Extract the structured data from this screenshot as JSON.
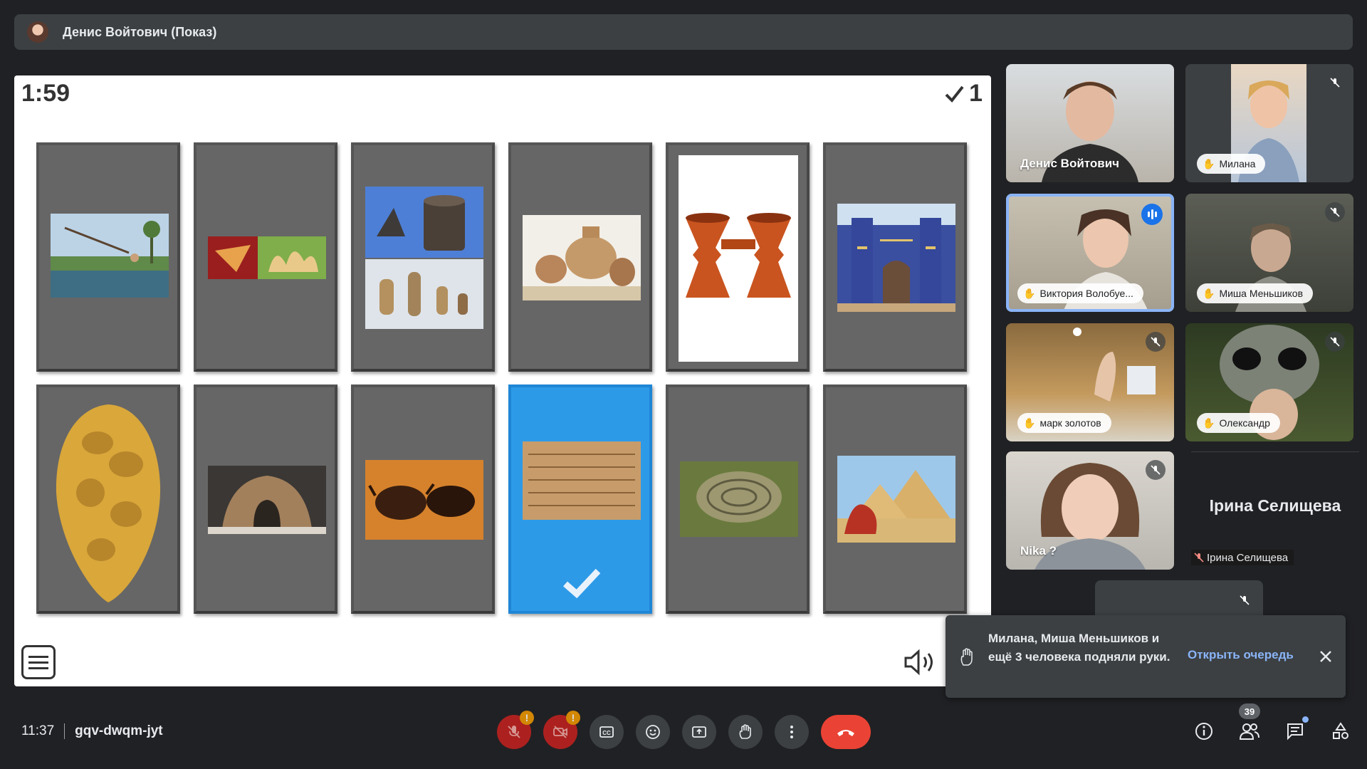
{
  "presenter": {
    "name": "Денис Войтович (Показ)"
  },
  "quiz": {
    "timer": "1:59",
    "score": "1",
    "cards": [
      {
        "icon": "irrigation-photo"
      },
      {
        "icon": "bone-tools-photo"
      },
      {
        "icon": "neolithic-pottery-photo"
      },
      {
        "icon": "pottery-collection-photo"
      },
      {
        "icon": "twin-vessel-photo"
      },
      {
        "icon": "ishtar-gate-photo"
      },
      {
        "icon": "hand-axe-photo"
      },
      {
        "icon": "mammoth-bone-hut-photo"
      },
      {
        "icon": "cave-painting-bison-photo"
      },
      {
        "icon": "cuneiform-tablet-photo",
        "selected": true
      },
      {
        "icon": "ancient-settlement-aerial-photo"
      },
      {
        "icon": "pyramids-camel-photo"
      }
    ]
  },
  "participants": [
    {
      "name": "Денис Войтович",
      "style": "plain",
      "muted": false
    },
    {
      "name": "Милана",
      "style": "pill",
      "hand": true,
      "muted": true
    },
    {
      "name": "Виктория Волобуе...",
      "style": "pill",
      "hand": true,
      "speaking": true
    },
    {
      "name": "Миша Меньшиков",
      "style": "pill",
      "hand": true,
      "muted": true
    },
    {
      "name": "марк золотов",
      "style": "pill",
      "hand": true,
      "muted": true
    },
    {
      "name": "Олександр",
      "style": "pill",
      "hand": true,
      "muted": true
    },
    {
      "name": "Nika ?",
      "style": "plain",
      "muted": true
    }
  ],
  "text_tile": {
    "big": "Ірина Селищева",
    "small": "Ірина Селищева"
  },
  "toast": {
    "message": "Милана, Миша Меньшиков и ещё 3 человека подняли руки.",
    "action": "Открыть очередь"
  },
  "meeting": {
    "time": "11:37",
    "code": "gqv-dwqm-jyt"
  },
  "controls": {
    "mic_warning": "!",
    "camera_warning": "!",
    "people_count": "39"
  },
  "colors": {
    "accent": "#8ab4f8",
    "end_call": "#ea4335",
    "selected_card": "#2d9ae8"
  }
}
